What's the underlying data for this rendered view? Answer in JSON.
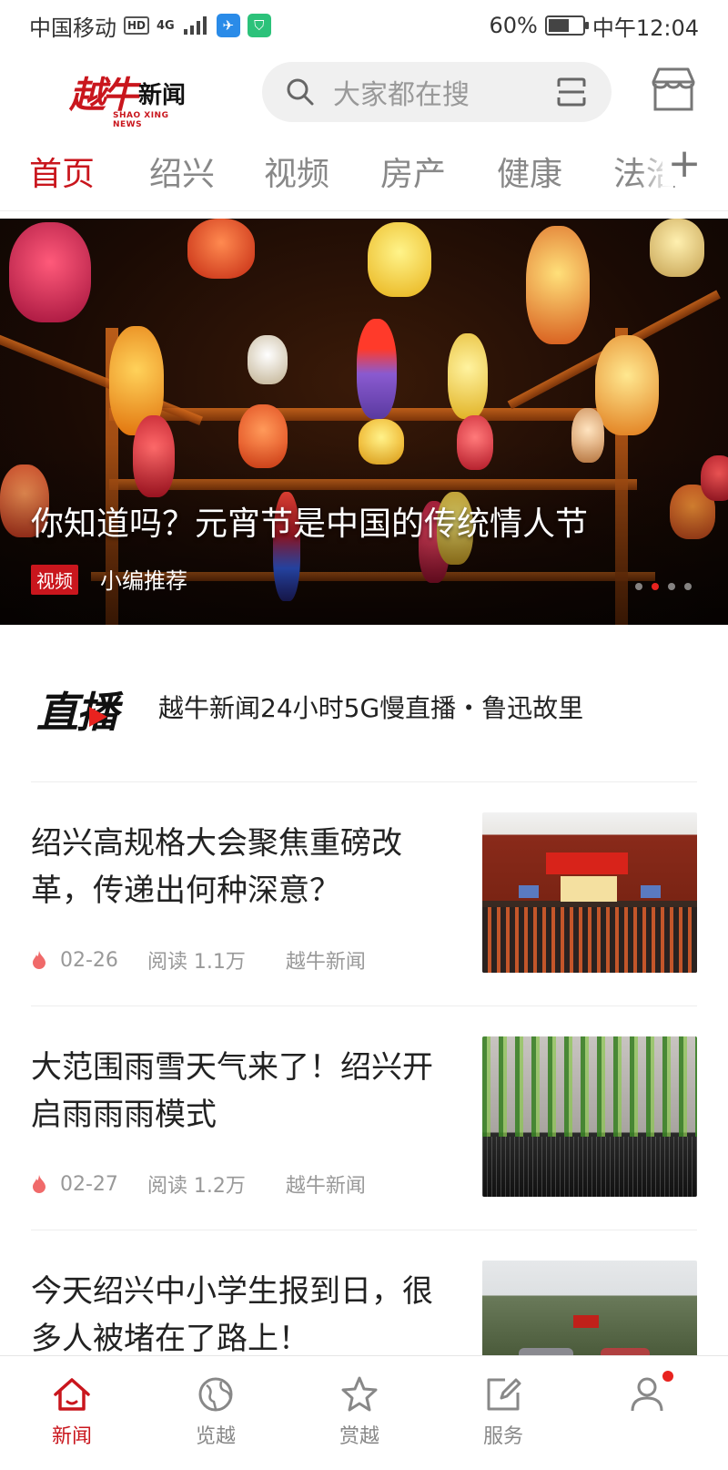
{
  "status_bar": {
    "carrier": "中国移动",
    "hd": "HD",
    "network": "4G",
    "battery_percent": "60%",
    "battery_level": 0.6,
    "time": "中午12:04"
  },
  "header": {
    "logo_mark": "越牛",
    "logo_name": "新闻",
    "logo_sub": "SHAO XING NEWS",
    "search_placeholder": "大家都在搜",
    "icons": [
      "search-icon",
      "scan-icon",
      "store-icon"
    ]
  },
  "tabs": {
    "items": [
      "首页",
      "绍兴",
      "视频",
      "房产",
      "健康",
      "法治"
    ],
    "active_index": 0,
    "add_label": "+"
  },
  "banner": {
    "title": "你知道吗？元宵节是中国的传统情人节",
    "tag": "视频",
    "source": "小编推荐",
    "slides": 4,
    "active_slide": 1
  },
  "live": {
    "logo": "直播",
    "text": "越牛新闻24小时5G慢直播・鲁迅故里"
  },
  "news": [
    {
      "title": "绍兴高规格大会聚焦重磅改革，传递出何种深意？",
      "date": "02-26",
      "reads": "阅读  1.1万",
      "source": "越牛新闻"
    },
    {
      "title": "大范围雨雪天气来了！绍兴开启雨雨雨模式",
      "date": "02-27",
      "reads": "阅读  1.2万",
      "source": "越牛新闻"
    },
    {
      "title": "今天绍兴中小学生报到日，很多人被堵在了路上！",
      "date": "",
      "reads": "",
      "source": ""
    }
  ],
  "bottom_nav": {
    "items": [
      {
        "label": "新闻",
        "icon": "home-icon"
      },
      {
        "label": "览越",
        "icon": "globe-icon"
      },
      {
        "label": "赏越",
        "icon": "star-icon"
      },
      {
        "label": "服务",
        "icon": "edit-icon"
      },
      {
        "label": "",
        "icon": "user-icon"
      }
    ],
    "active_index": 0
  },
  "colors": {
    "brand_red": "#c9161d",
    "accent_red": "#e8231f"
  }
}
